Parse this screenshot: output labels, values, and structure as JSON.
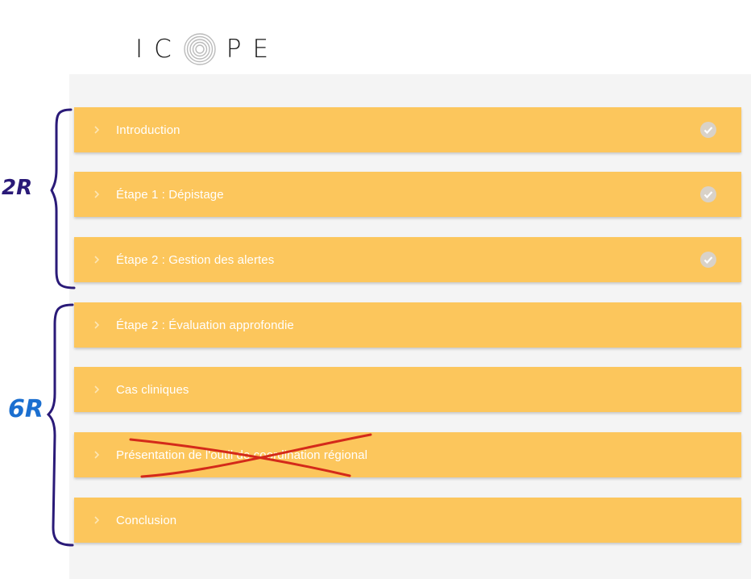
{
  "logo": {
    "text": "ICOPE",
    "prefix": "IC",
    "suffix": "PE"
  },
  "modules": [
    {
      "label": "Introduction",
      "completed": true
    },
    {
      "label": "Étape 1 : Dépistage",
      "completed": true
    },
    {
      "label": "Étape 2 : Gestion des alertes",
      "completed": true
    },
    {
      "label": "Étape 2 : Évaluation approfondie",
      "completed": false
    },
    {
      "label": "Cas cliniques",
      "completed": false
    },
    {
      "label": "Présentation de l'outil de coordination régional",
      "completed": false
    },
    {
      "label": "Conclusion",
      "completed": false
    }
  ],
  "annotations": {
    "group1_label": "2R",
    "group2_label": "6R",
    "group1_color": "#2a1a78",
    "group2_color": "#1b6fd0",
    "strike_color": "#d42a1a"
  },
  "colors": {
    "module_bg": "#fcc65c",
    "panel_bg": "#f4f4f4",
    "check_bg": "#d9d2c8"
  }
}
